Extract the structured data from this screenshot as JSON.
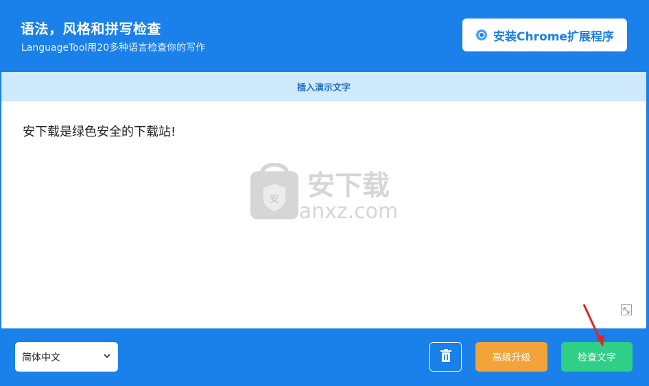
{
  "header": {
    "title": "语法，风格和拼写检查",
    "subtitle": "LanguageTool用20多种语言检查你的写作",
    "install_button": "安装Chrome扩展程序"
  },
  "demo_bar": {
    "label": "插入演示文字"
  },
  "editor": {
    "text": "安下载是绿色安全的下载站!"
  },
  "watermark": {
    "text_cn": "安下载",
    "text_en": "anxz.com"
  },
  "footer": {
    "language_select": "简体中文",
    "upgrade_button": "高级升级",
    "check_button": "检查文字"
  },
  "colors": {
    "primary": "#1a80ea",
    "demo_bar": "#cfe9fd",
    "upgrade": "#f2a33a",
    "check": "#2fcf88"
  }
}
